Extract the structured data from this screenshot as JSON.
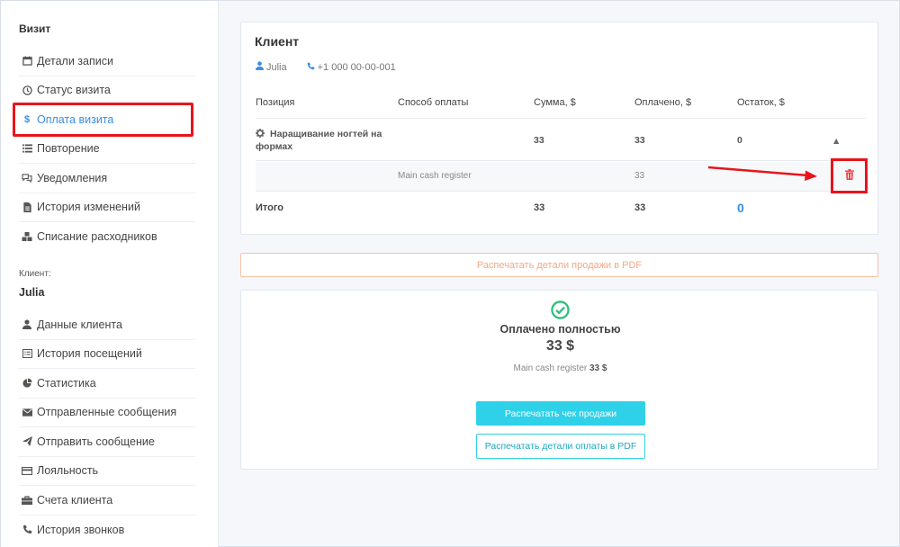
{
  "sidebar": {
    "heading": "Визит",
    "visit_items": [
      {
        "label": "Детали записи",
        "icon": "calendar-icon"
      },
      {
        "label": "Статус визита",
        "icon": "clock-icon"
      },
      {
        "label": "Оплата визита",
        "icon": "dollar-icon",
        "active": true
      },
      {
        "label": "Повторение",
        "icon": "list-icon"
      },
      {
        "label": "Уведомления",
        "icon": "comments-icon"
      },
      {
        "label": "История изменений",
        "icon": "file-icon"
      },
      {
        "label": "Списание расходников",
        "icon": "cubes-icon"
      }
    ],
    "client_caption": "Клиент:",
    "client_name": "Julia",
    "client_items": [
      {
        "label": "Данные клиента",
        "icon": "user-icon"
      },
      {
        "label": "История посещений",
        "icon": "list-alt-icon"
      },
      {
        "label": "Статистика",
        "icon": "pie-chart-icon"
      },
      {
        "label": "Отправленные сообщения",
        "icon": "envelope-icon"
      },
      {
        "label": "Отправить сообщение",
        "icon": "paper-plane-icon"
      },
      {
        "label": "Лояльность",
        "icon": "credit-card-icon"
      },
      {
        "label": "Счета клиента",
        "icon": "briefcase-icon"
      },
      {
        "label": "История звонков",
        "icon": "phone-icon"
      }
    ]
  },
  "client_card": {
    "title": "Клиент",
    "client_name": "Julia",
    "phone": "+1 000 00-00-001"
  },
  "table": {
    "headers": {
      "position": "Позиция",
      "payment_method": "Способ оплаты",
      "sum": "Сумма, $",
      "paid": "Оплачено, $",
      "balance": "Остаток, $"
    },
    "service_row": {
      "name_line1": "Наращивание ногтей на",
      "name_line2": "формах",
      "sum": "33",
      "paid": "33",
      "balance": "0"
    },
    "payment_row": {
      "method": "Main cash register",
      "paid": "33"
    },
    "total_row": {
      "label": "Итого",
      "sum": "33",
      "paid": "33",
      "balance": "0"
    }
  },
  "print_sale_pdf_label": "Распечатать детали продажи в PDF",
  "payment_status": {
    "title": "Оплачено полностью",
    "amount": "33 $",
    "register_label": "Main cash register",
    "register_amount": "33 $",
    "print_receipt_label": "Распечатать чек продажи",
    "print_payment_pdf_label": "Распечатать детали оплаты в PDF"
  },
  "colors": {
    "accent": "#3a8ee6",
    "highlight_red": "#e8141c",
    "success_green": "#2ebf7e",
    "cyan_button": "#2ed1e8",
    "pdf_orange": "#f4a888"
  }
}
